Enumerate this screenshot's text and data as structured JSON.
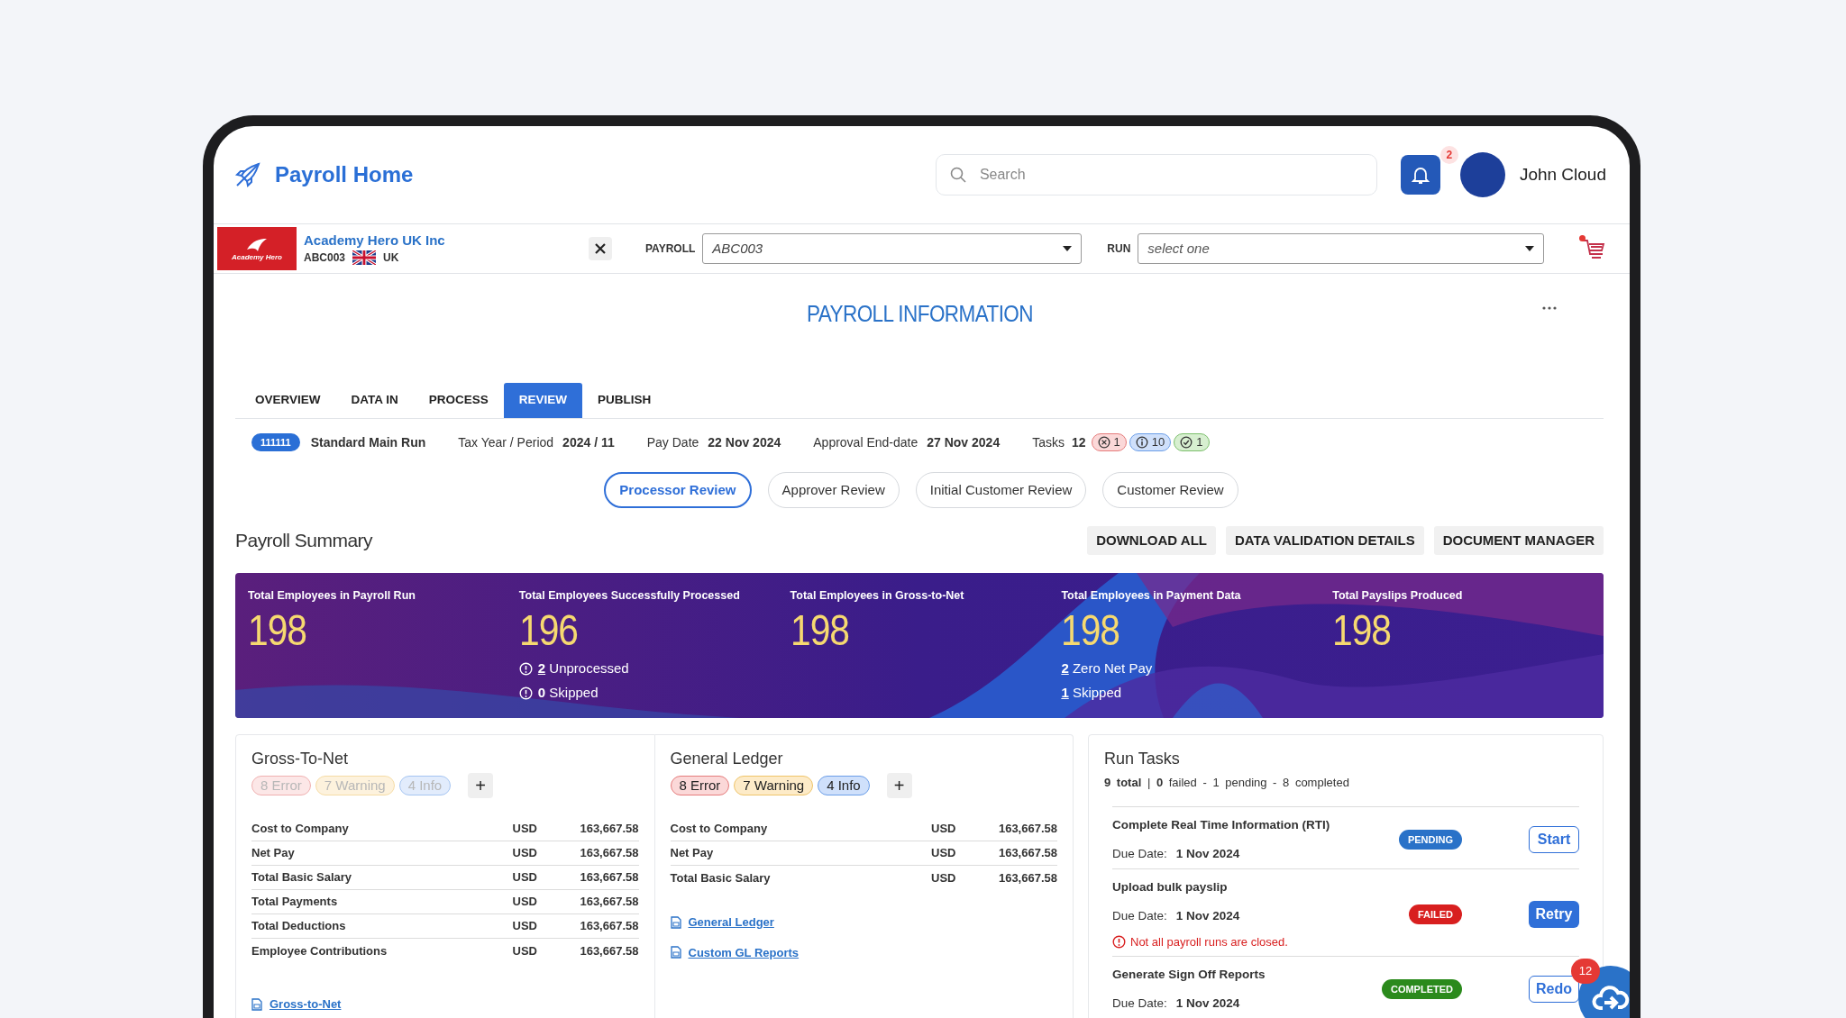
{
  "app": {
    "title": "Payroll Home"
  },
  "search": {
    "placeholder": "Search"
  },
  "notifications": {
    "count": "2"
  },
  "user": {
    "name": "John Cloud"
  },
  "company": {
    "logo_text": "Academy Hero",
    "name": "Academy Hero UK Inc",
    "code": "ABC003",
    "country": "UK"
  },
  "filters": [
    {
      "label": "PAYROLL",
      "value": "ABC003"
    },
    {
      "label": "RUN",
      "placeholder": "select one"
    }
  ],
  "cart": {
    "alert": true
  },
  "page_title": "PAYROLL INFORMATION",
  "tabs": [
    {
      "label": "OVERVIEW",
      "selected": false
    },
    {
      "label": "DATA IN",
      "selected": false
    },
    {
      "label": "PROCESS",
      "selected": false
    },
    {
      "label": "REVIEW",
      "selected": true
    },
    {
      "label": "PUBLISH",
      "selected": false
    }
  ],
  "run": {
    "id": "111111",
    "name": "Standard Main Run",
    "fields": [
      {
        "label": "Tax Year / Period",
        "value": "2024 / 11"
      },
      {
        "label": "Pay Date",
        "value": "22 Nov 2024"
      },
      {
        "label": "Approval End-date",
        "value": "27 Nov 2024"
      }
    ],
    "tasks": {
      "label": "Tasks",
      "count": "12",
      "badges": [
        {
          "kind": "error",
          "count": "1"
        },
        {
          "kind": "info",
          "count": "10"
        },
        {
          "kind": "success",
          "count": "1"
        }
      ]
    }
  },
  "review_stages": [
    {
      "label": "Processor Review",
      "selected": true
    },
    {
      "label": "Approver Review",
      "selected": false
    },
    {
      "label": "Initial Customer Review",
      "selected": false
    },
    {
      "label": "Customer Review",
      "selected": false
    }
  ],
  "summary": {
    "title": "Payroll Summary",
    "buttons": [
      "DOWNLOAD ALL",
      "DATA VALIDATION DETAILS",
      "DOCUMENT MANAGER"
    ]
  },
  "stats": [
    {
      "label": "Total Employees in Payroll Run",
      "value": "198"
    },
    {
      "label": "Total Employees Successfully Processed",
      "value": "196",
      "notes": [
        {
          "kind": "alert",
          "count": "2",
          "text": "Unprocessed",
          "link": true
        },
        {
          "kind": "alert",
          "count": "0",
          "text": "Skipped",
          "link": false
        }
      ]
    },
    {
      "label": "Total Employees in Gross-to-Net",
      "value": "198"
    },
    {
      "label": "Total Employees in Payment Data",
      "value": "198",
      "notes": [
        {
          "kind": "plain",
          "count": "2",
          "text": "Zero Net Pay",
          "link": true
        },
        {
          "kind": "plain",
          "count": "1",
          "text": "Skipped",
          "link": true
        }
      ]
    },
    {
      "label": "Total Payslips Produced",
      "value": "198"
    }
  ],
  "panels": [
    {
      "title": "Gross-To-Net",
      "faded": true,
      "badges": [
        {
          "kind": "error",
          "label": "8 Error"
        },
        {
          "kind": "warning",
          "label": "7 Warning"
        },
        {
          "kind": "info",
          "label": "4 Info"
        }
      ],
      "add": "+",
      "rows": [
        {
          "label": "Cost to Company",
          "currency": "USD",
          "amount": "163,667.58"
        },
        {
          "label": "Net Pay",
          "currency": "USD",
          "amount": "163,667.58"
        },
        {
          "label": "Total Basic Salary",
          "currency": "USD",
          "amount": "163,667.58"
        },
        {
          "label": "Total Payments",
          "currency": "USD",
          "amount": "163,667.58"
        },
        {
          "label": "Total Deductions",
          "currency": "USD",
          "amount": "163,667.58"
        },
        {
          "label": "Employee Contributions",
          "currency": "USD",
          "amount": "163,667.58"
        }
      ],
      "links": [
        "Gross-to-Net"
      ]
    },
    {
      "title": "General Ledger",
      "faded": false,
      "badges": [
        {
          "kind": "error",
          "label": "8 Error"
        },
        {
          "kind": "warning",
          "label": "7 Warning"
        },
        {
          "kind": "info",
          "label": "4 Info"
        }
      ],
      "add": "+",
      "rows": [
        {
          "label": "Cost to Company",
          "currency": "USD",
          "amount": "163,667.58"
        },
        {
          "label": "Net Pay",
          "currency": "USD",
          "amount": "163,667.58"
        },
        {
          "label": "Total Basic Salary",
          "currency": "USD",
          "amount": "163,667.58"
        }
      ],
      "links": [
        "General Ledger",
        "Custom GL Reports"
      ]
    }
  ],
  "run_tasks": {
    "title": "Run Tasks",
    "summary": "**9 total** | **0** failed - 1 pending - 8 completed",
    "tasks": [
      {
        "name": "Complete Real Time Information (RTI)",
        "due_label": "Due Date:",
        "due": "1 Nov 2024",
        "status": "PENDING",
        "kind": "pending",
        "action": "Start"
      },
      {
        "name": "Upload bulk payslip",
        "due_label": "Due Date:",
        "due": "1 Nov 2024",
        "status": "FAILED",
        "kind": "failed",
        "action": "Retry",
        "error": "Not all payroll runs are closed."
      },
      {
        "name": "Generate Sign Off Reports",
        "due_label": "Due Date:",
        "due": "1 Nov 2024",
        "status": "COMPLETED",
        "kind": "completed",
        "action": "Redo"
      }
    ]
  },
  "sync": {
    "count": "12"
  }
}
